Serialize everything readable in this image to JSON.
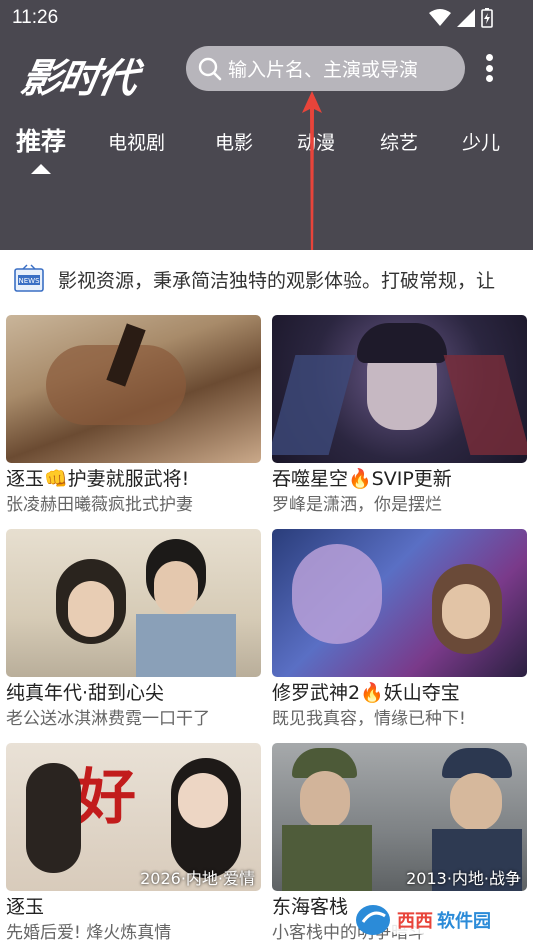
{
  "status": {
    "time": "11:26"
  },
  "header": {
    "logo": "影时代",
    "search_placeholder": "输入片名、主演或导演"
  },
  "tabs": [
    {
      "label": "推荐",
      "active": true
    },
    {
      "label": "电视剧"
    },
    {
      "label": "电影"
    },
    {
      "label": "动漫"
    },
    {
      "label": "综艺"
    },
    {
      "label": "少儿"
    }
  ],
  "notice": {
    "icon": "news-icon",
    "text": "影视资源，秉承简洁独特的观影体验。打破常规，让"
  },
  "cards": [
    {
      "title": "逐玉👊护妻就服武将!",
      "subtitle": "张凌赫田曦薇疯批式护妻",
      "badge": ""
    },
    {
      "title": "吞噬星空🔥SVIP更新",
      "subtitle": "罗峰是潇洒，你是摆烂",
      "badge": ""
    },
    {
      "title": "纯真年代·甜到心尖",
      "subtitle": "老公送冰淇淋费霓一口干了",
      "badge": ""
    },
    {
      "title": "修罗武神2🔥妖山夺宝",
      "subtitle": "既见我真容，情缘已种下!",
      "badge": ""
    },
    {
      "title": "逐玉",
      "subtitle": "先婚后爱! 烽火炼真情",
      "badge": "2026·内地·爱情"
    },
    {
      "title": "东海客栈",
      "subtitle": "小客栈中的明争暗斗",
      "badge": "2013·内地·战争"
    }
  ],
  "watermark": {
    "text": "西西软件园",
    "sub": "CR173.COM"
  },
  "colors": {
    "header_bg": "#4a4850",
    "search_bg": "#b7b5bb",
    "arrow": "#e8443a"
  }
}
